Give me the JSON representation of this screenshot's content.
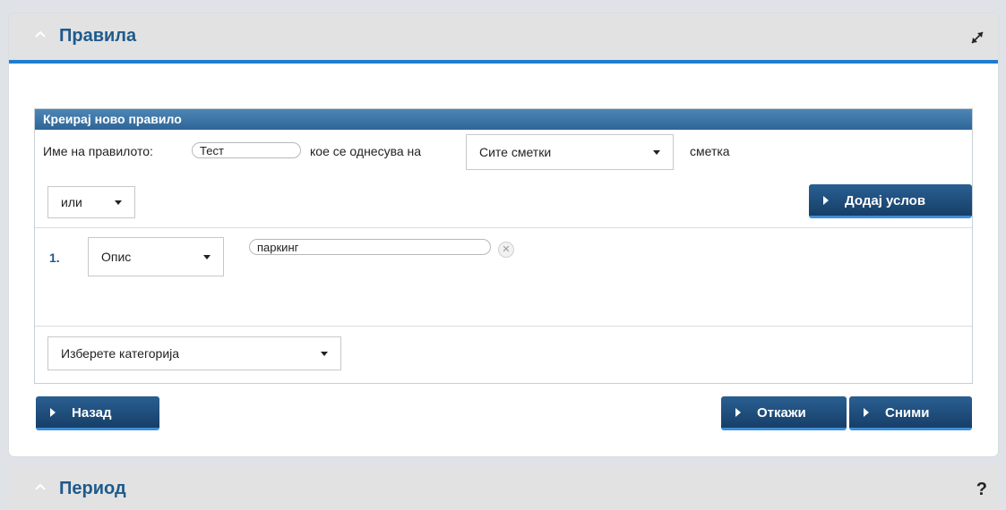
{
  "rules_panel": {
    "title": "Правила",
    "collapse_icon": "chevron-up-icon",
    "expand_icon": "expand-icon"
  },
  "rule_form": {
    "heading": "Креирај ново правило",
    "name_label": "Име на правилото:",
    "name_value": "Тест",
    "applies_to_label": "кое се однесува на",
    "account_select_value": "Сите сметки",
    "account_suffix": "сметка",
    "logic_select_value": "или",
    "add_condition_label": "Додај услов",
    "conditions": [
      {
        "index": "1.",
        "field": "Опис",
        "value": "паркинг"
      }
    ],
    "category_select_value": "Изберете категорија"
  },
  "actions": {
    "back_label": "Назад",
    "cancel_label": "Откажи",
    "save_label": "Сними"
  },
  "period_panel": {
    "title": "Период",
    "help_label": "?"
  },
  "colors": {
    "accent_blue": "#1f7dcf",
    "title_blue": "#1e5a8c",
    "button_dark": "#1c4a78"
  }
}
